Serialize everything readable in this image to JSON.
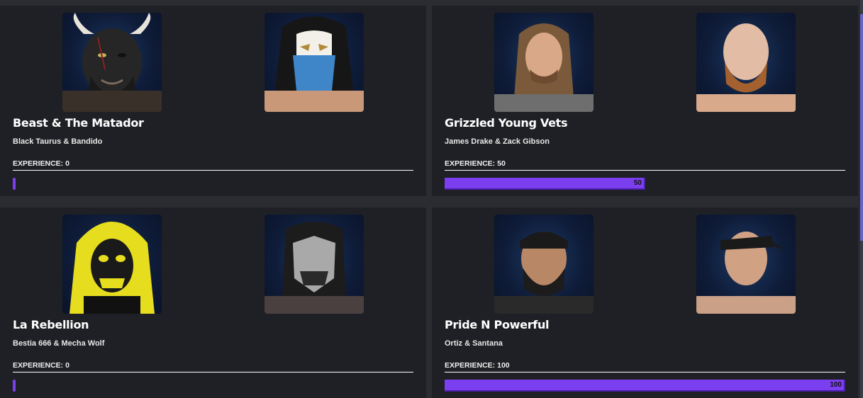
{
  "teams": [
    {
      "name": "Beast & The Matador",
      "members": "Black Taurus & Bandido",
      "experience_label": "EXPERIENCE: 0",
      "experience": 0,
      "experience_text": "",
      "portraits": [
        "bull-mask-wrestler-portrait",
        "blue-mask-wrestler-portrait"
      ]
    },
    {
      "name": "Grizzled Young Vets",
      "members": "James Drake & Zack Gibson",
      "experience_label": "EXPERIENCE: 50",
      "experience": 50,
      "experience_text": "50",
      "portraits": [
        "long-hair-wrestler-portrait",
        "bearded-wrestler-portrait"
      ]
    },
    {
      "name": "La Rebellion",
      "members": "Bestia 666 & Mecha Wolf",
      "experience_label": "EXPERIENCE: 0",
      "experience": 0,
      "experience_text": "",
      "portraits": [
        "skull-mask-wrestler-portrait",
        "silver-mask-wrestler-portrait"
      ]
    },
    {
      "name": "Pride N Powerful",
      "members": "Ortiz & Santana",
      "experience_label": "EXPERIENCE: 100",
      "experience": 100,
      "experience_text": "100",
      "portraits": [
        "bandana-wrestler-portrait",
        "bandana-wrestler-portrait"
      ]
    }
  ],
  "colors": {
    "background": "#2a2c31",
    "card": "#1f2025",
    "accent_bar": "#7b3ff0",
    "portrait_bg": "#0f1d3a"
  },
  "experience_max": 100
}
